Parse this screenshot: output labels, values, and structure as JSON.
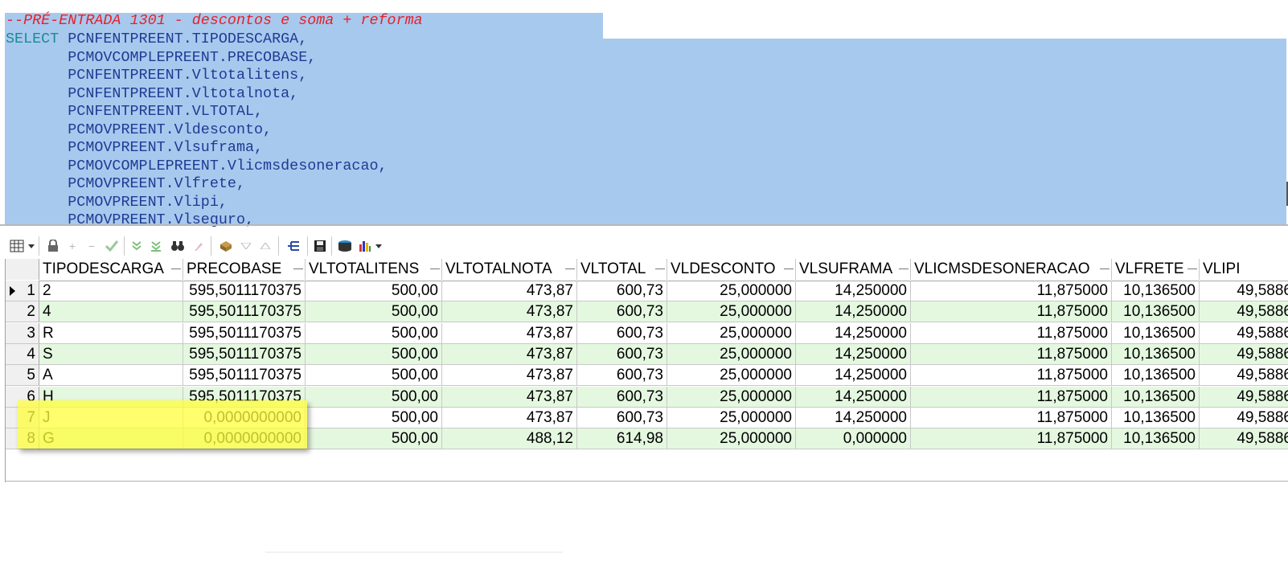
{
  "editor": {
    "comment": "--PRÉ-ENTRADA 1301 - descontos e soma + reforma",
    "keyword": "SELECT",
    "lines": [
      " PCNFENTPREENT.TIPODESCARGA,",
      "       PCMOVCOMPLEPREENT.PRECOBASE,",
      "       PCNFENTPREENT.Vltotalitens,",
      "       PCNFENTPREENT.Vltotalnota,",
      "       PCNFENTPREENT.VLTOTAL,",
      "       PCMOVPREENT.Vldesconto,",
      "       PCMOVPREENT.Vlsuframa,",
      "       PCMOVCOMPLEPREENT.Vlicmsdesoneracao,",
      "       PCMOVPREENT.Vlfrete,",
      "       PCMOVPREENT.Vlipi,",
      "       PCMOVPREENT.Vlseguro,"
    ]
  },
  "toolbar": {
    "icons": [
      "grid-view-icon",
      "dropdown-arrow-icon",
      "lock-icon",
      "add-icon",
      "remove-icon",
      "post-check-icon",
      "filter-down-icon",
      "filter-clear-icon",
      "find-binoculars-icon",
      "clear-eraser-icon",
      "fetch-box-icon",
      "sort-down-icon",
      "sort-up-icon",
      "tree-view-icon",
      "save-icon",
      "export-icon",
      "chart-icon",
      "chart-dropdown-icon"
    ]
  },
  "grid": {
    "columns": [
      "TIPODESCARGA",
      "PRECOBASE",
      "VLTOTALITENS",
      "VLTOTALNOTA",
      "VLTOTAL",
      "VLDESCONTO",
      "VLSUFRAMA",
      "VLICMSDESONERACAO",
      "VLFRETE",
      "VLIPI"
    ],
    "rows": [
      {
        "n": "1",
        "TIPODESCARGA": "2",
        "PRECOBASE": "595,5011170375",
        "VLTOTALITENS": "500,00",
        "VLTOTALNOTA": "473,87",
        "VLTOTAL": "600,73",
        "VLDESCONTO": "25,000000",
        "VLSUFRAMA": "14,250000",
        "VLICMSDESONERACAO": "11,875000",
        "VLFRETE": "10,136500",
        "VLIPI": "49,5886"
      },
      {
        "n": "2",
        "TIPODESCARGA": "4",
        "PRECOBASE": "595,5011170375",
        "VLTOTALITENS": "500,00",
        "VLTOTALNOTA": "473,87",
        "VLTOTAL": "600,73",
        "VLDESCONTO": "25,000000",
        "VLSUFRAMA": "14,250000",
        "VLICMSDESONERACAO": "11,875000",
        "VLFRETE": "10,136500",
        "VLIPI": "49,5886"
      },
      {
        "n": "3",
        "TIPODESCARGA": "R",
        "PRECOBASE": "595,5011170375",
        "VLTOTALITENS": "500,00",
        "VLTOTALNOTA": "473,87",
        "VLTOTAL": "600,73",
        "VLDESCONTO": "25,000000",
        "VLSUFRAMA": "14,250000",
        "VLICMSDESONERACAO": "11,875000",
        "VLFRETE": "10,136500",
        "VLIPI": "49,5886"
      },
      {
        "n": "4",
        "TIPODESCARGA": "S",
        "PRECOBASE": "595,5011170375",
        "VLTOTALITENS": "500,00",
        "VLTOTALNOTA": "473,87",
        "VLTOTAL": "600,73",
        "VLDESCONTO": "25,000000",
        "VLSUFRAMA": "14,250000",
        "VLICMSDESONERACAO": "11,875000",
        "VLFRETE": "10,136500",
        "VLIPI": "49,5886"
      },
      {
        "n": "5",
        "TIPODESCARGA": "A",
        "PRECOBASE": "595,5011170375",
        "VLTOTALITENS": "500,00",
        "VLTOTALNOTA": "473,87",
        "VLTOTAL": "600,73",
        "VLDESCONTO": "25,000000",
        "VLSUFRAMA": "14,250000",
        "VLICMSDESONERACAO": "11,875000",
        "VLFRETE": "10,136500",
        "VLIPI": "49,5886"
      },
      {
        "n": "6",
        "TIPODESCARGA": "H",
        "PRECOBASE": "595,5011170375",
        "VLTOTALITENS": "500,00",
        "VLTOTALNOTA": "473,87",
        "VLTOTAL": "600,73",
        "VLDESCONTO": "25,000000",
        "VLSUFRAMA": "14,250000",
        "VLICMSDESONERACAO": "11,875000",
        "VLFRETE": "10,136500",
        "VLIPI": "49,5886"
      },
      {
        "n": "7",
        "TIPODESCARGA": "J",
        "PRECOBASE": "0,0000000000",
        "VLTOTALITENS": "500,00",
        "VLTOTALNOTA": "473,87",
        "VLTOTAL": "600,73",
        "VLDESCONTO": "25,000000",
        "VLSUFRAMA": "14,250000",
        "VLICMSDESONERACAO": "11,875000",
        "VLFRETE": "10,136500",
        "VLIPI": "49,5886"
      },
      {
        "n": "8",
        "TIPODESCARGA": "G",
        "PRECOBASE": "0,0000000000",
        "VLTOTALITENS": "500,00",
        "VLTOTALNOTA": "488,12",
        "VLTOTAL": "614,98",
        "VLDESCONTO": "25,000000",
        "VLSUFRAMA": "0,000000",
        "VLICMSDESONERACAO": "11,875000",
        "VLFRETE": "10,136500",
        "VLIPI": "49,5886"
      }
    ],
    "current_row": "1",
    "colors": {
      "alt_row": "#e4f8e0",
      "highlight": "#ffff3c",
      "selection": "#a7c9ee"
    }
  }
}
